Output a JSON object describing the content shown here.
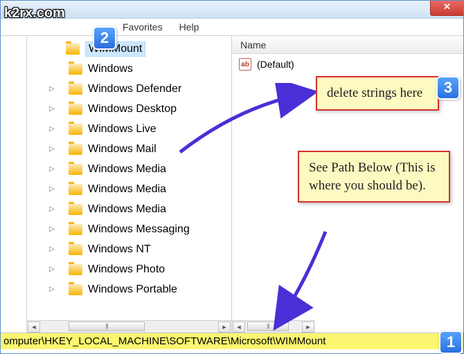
{
  "watermark": "k2rx.com",
  "menubar": {
    "favorites": "Favorites",
    "help": "Help"
  },
  "tree": {
    "items": [
      {
        "label": "WIMMount",
        "selected": true,
        "expander": false
      },
      {
        "label": "Windows",
        "expander": false
      },
      {
        "label": "Windows Defender",
        "expander": true
      },
      {
        "label": "Windows Desktop",
        "expander": true
      },
      {
        "label": "Windows Live",
        "expander": true
      },
      {
        "label": "Windows Mail",
        "expander": true
      },
      {
        "label": "Windows Media",
        "expander": true
      },
      {
        "label": "Windows Media",
        "expander": true
      },
      {
        "label": "Windows Media",
        "expander": true
      },
      {
        "label": "Windows Messaging",
        "expander": true
      },
      {
        "label": "Windows NT",
        "expander": true
      },
      {
        "label": "Windows Photo",
        "expander": true
      },
      {
        "label": "Windows Portable",
        "expander": true
      }
    ]
  },
  "values": {
    "header": "Name",
    "items": [
      {
        "icon": "ab",
        "label": "(Default)"
      }
    ]
  },
  "statusbar": "omputer\\HKEY_LOCAL_MACHINE\\SOFTWARE\\Microsoft\\WIMMount",
  "steps": {
    "s1": "1",
    "s2": "2",
    "s3": "3"
  },
  "callouts": {
    "c1": "delete strings here",
    "c2": "See Path Below (This is where you should be)."
  }
}
